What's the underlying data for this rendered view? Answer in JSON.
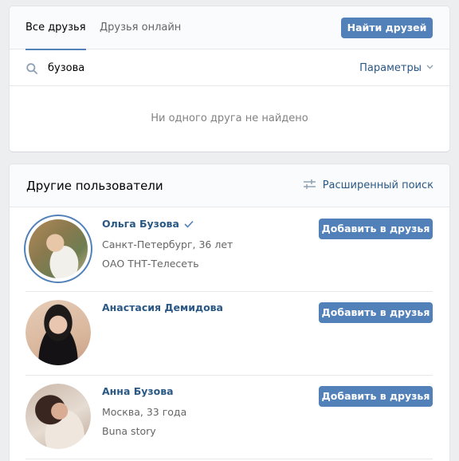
{
  "tabs": [
    {
      "label": "Все друзья"
    },
    {
      "label": "Друзья онлайн"
    }
  ],
  "find_friends_label": "Найти друзей",
  "search": {
    "value": "бузова"
  },
  "parameters_label": "Параметры",
  "empty_message": "Ни одного друга не найдено",
  "others": {
    "title": "Другие пользователи",
    "advanced_search_label": "Расширенный поиск",
    "users": [
      {
        "name": "Ольга Бузова",
        "verified": true,
        "location": "Санкт-Петербург, 36 лет",
        "work": "ОАО ТНТ-Телесеть",
        "add_label": "Добавить в друзья"
      },
      {
        "name": "Анастасия Демидова",
        "add_label": "Добавить в друзья"
      },
      {
        "name": "Анна Бузова",
        "location": "Москва, 33 года",
        "work": "Buna story",
        "add_label": "Добавить в друзья"
      }
    ]
  },
  "colors": {
    "accent": "#5181b8",
    "link": "#2a5885",
    "background": "#edeef0"
  }
}
